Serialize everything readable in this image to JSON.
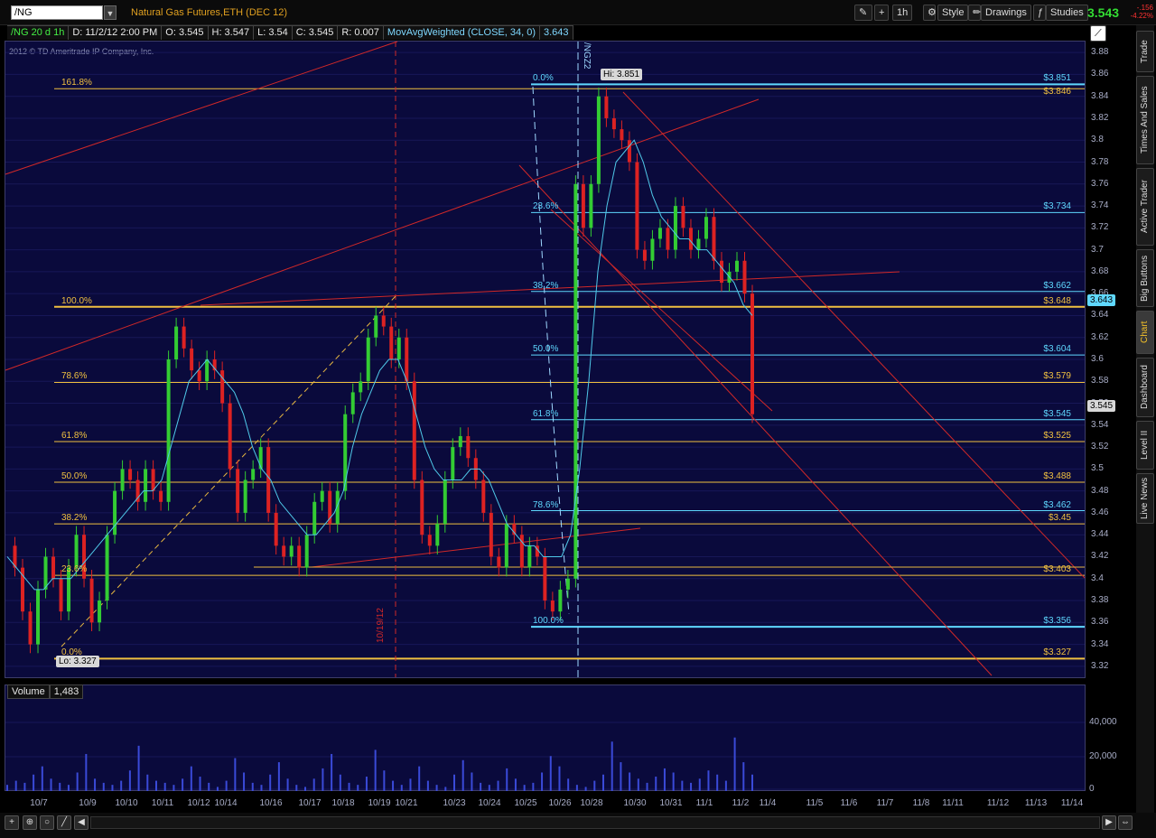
{
  "toolbar": {
    "symbol": "/NG",
    "description": "Natural Gas Futures,ETH (DEC 12)",
    "timeframe": "1h",
    "style_label": "Style",
    "drawings_label": "Drawings",
    "studies_label": "Studies",
    "last_price": "3.543",
    "net_change": "-.156",
    "pct_change": "-4.22%"
  },
  "header": {
    "chart_label": "/NG 20 d 1h",
    "date": "D: 11/2/12 2:00 PM",
    "open": "O: 3.545",
    "high": "H: 3.547",
    "low": "L: 3.54",
    "close": "C: 3.545",
    "range": "R: 0.007",
    "study": "MovAvgWeighted (CLOSE, 34, 0)",
    "study_value": "3.643",
    "copyright": "2012 © TD Ameritrade IP Company, Inc."
  },
  "volume_header": {
    "label": "Volume",
    "value": "1,483"
  },
  "right_tabs": [
    "Trade",
    "Times And Sales",
    "Active Trader",
    "Big Buttons",
    "Chart",
    "Dashboard",
    "Level II",
    "Live News"
  ],
  "active_tab": "Chart",
  "chart_data": {
    "type": "line",
    "title": "",
    "price_axis": {
      "ticks": [
        "3.88",
        "3.86",
        "3.84",
        "3.82",
        "3.8",
        "3.78",
        "3.76",
        "3.74",
        "3.72",
        "3.7",
        "3.68",
        "3.66",
        "3.64",
        "3.62",
        "3.6",
        "3.58",
        "3.56",
        "3.54",
        "3.52",
        "3.5",
        "3.48",
        "3.46",
        "3.44",
        "3.42",
        "3.4",
        "3.38",
        "3.36",
        "3.34",
        "3.32"
      ],
      "ylim": [
        3.31,
        3.89
      ]
    },
    "volume_axis": {
      "ticks": [
        "40,000",
        "20,000",
        "0"
      ]
    },
    "x_ticks": [
      "10/7",
      "10/9",
      "10/10",
      "10/11",
      "10/12",
      "10/14",
      "10/16",
      "10/17",
      "10/18",
      "10/19",
      "10/21",
      "10/23",
      "10/24",
      "10/25",
      "10/26",
      "10/28",
      "10/30",
      "10/31",
      "11/1",
      "11/2",
      "11/4",
      "11/5",
      "11/6",
      "11/7",
      "11/8",
      "11/11",
      "11/12",
      "11/13",
      "11/14"
    ],
    "fib_left": {
      "color": "#f0c040",
      "levels": [
        {
          "label": "161.8%",
          "price": 3.847,
          "value": ""
        },
        {
          "label": "100.0%",
          "price": 3.648,
          "value": "$3.648"
        },
        {
          "label": "78.6%",
          "price": 3.579,
          "value": "$3.579"
        },
        {
          "label": "61.8%",
          "price": 3.525,
          "value": "$3.525"
        },
        {
          "label": "50.0%",
          "price": 3.488,
          "value": "$3.488"
        },
        {
          "label": "38.2%",
          "price": 3.45,
          "value": "$3.45"
        },
        {
          "label": "23.6%",
          "price": 3.403,
          "value": "$3.403"
        },
        {
          "label": "0.0%",
          "price": 3.327,
          "value": "$3.327"
        }
      ]
    },
    "fib_right": {
      "color": "#5fd8ff",
      "levels": [
        {
          "label": "0.0%",
          "price": 3.851,
          "value": "$3.851"
        },
        {
          "label": "23.6%",
          "price": 3.734,
          "value": "$3.734"
        },
        {
          "label": "38.2%",
          "price": 3.662,
          "value": "$3.662"
        },
        {
          "label": "50.0%",
          "price": 3.604,
          "value": "$3.604"
        },
        {
          "label": "61.8%",
          "price": 3.545,
          "value": "$3.545"
        },
        {
          "label": "78.6%",
          "price": 3.462,
          "value": "$3.462"
        },
        {
          "label": "100.0%",
          "price": 3.356,
          "value": "$3.356"
        }
      ]
    },
    "extra_label": "$3.846",
    "annotations": {
      "high": "Hi: 3.851",
      "low": "Lo: 3.327",
      "date_marker": "10/19/12",
      "contract_marker": "/NGZ2",
      "current_price": "3.545",
      "ma_price": "3.643"
    },
    "price_path": [
      3.43,
      3.41,
      3.37,
      3.34,
      3.39,
      3.42,
      3.4,
      3.37,
      3.41,
      3.44,
      3.4,
      3.36,
      3.38,
      3.44,
      3.48,
      3.5,
      3.49,
      3.47,
      3.5,
      3.48,
      3.47,
      3.6,
      3.63,
      3.61,
      3.59,
      3.58,
      3.6,
      3.59,
      3.56,
      3.5,
      3.46,
      3.49,
      3.5,
      3.52,
      3.46,
      3.43,
      3.42,
      3.43,
      3.41,
      3.44,
      3.47,
      3.48,
      3.45,
      3.48,
      3.55,
      3.57,
      3.58,
      3.62,
      3.64,
      3.63,
      3.6,
      3.62,
      3.58,
      3.49,
      3.44,
      3.43,
      3.45,
      3.49,
      3.52,
      3.53,
      3.51,
      3.49,
      3.46,
      3.42,
      3.41,
      3.45,
      3.44,
      3.41,
      3.43,
      3.42,
      3.38,
      3.37,
      3.39,
      3.4,
      3.76,
      3.72,
      3.76,
      3.84,
      3.82,
      3.81,
      3.8,
      3.78,
      3.7,
      3.69,
      3.71,
      3.72,
      3.7,
      3.74,
      3.72,
      3.7,
      3.71,
      3.73,
      3.69,
      3.67,
      3.68,
      3.69,
      3.66,
      3.55
    ],
    "ma_path": [
      3.42,
      3.41,
      3.4,
      3.39,
      3.39,
      3.4,
      3.4,
      3.4,
      3.41,
      3.42,
      3.43,
      3.44,
      3.45,
      3.46,
      3.47,
      3.48,
      3.48,
      3.49,
      3.52,
      3.55,
      3.58,
      3.59,
      3.6,
      3.59,
      3.58,
      3.57,
      3.55,
      3.52,
      3.5,
      3.49,
      3.47,
      3.46,
      3.45,
      3.44,
      3.44,
      3.45,
      3.46,
      3.48,
      3.52,
      3.55,
      3.57,
      3.59,
      3.6,
      3.6,
      3.58,
      3.55,
      3.52,
      3.5,
      3.49,
      3.49,
      3.49,
      3.5,
      3.5,
      3.49,
      3.47,
      3.45,
      3.44,
      3.43,
      3.43,
      3.42,
      3.42,
      3.42,
      3.44,
      3.5,
      3.58,
      3.68,
      3.74,
      3.78,
      3.79,
      3.8,
      3.78,
      3.75,
      3.73,
      3.72,
      3.71,
      3.71,
      3.7,
      3.7,
      3.69,
      3.68,
      3.67,
      3.65,
      3.64
    ],
    "volume_path": [
      3,
      5,
      4,
      8,
      12,
      6,
      4,
      3,
      9,
      18,
      6,
      4,
      3,
      5,
      10,
      22,
      8,
      5,
      4,
      3,
      6,
      12,
      7,
      4,
      2,
      5,
      16,
      9,
      4,
      3,
      8,
      14,
      6,
      3,
      2,
      6,
      11,
      18,
      8,
      4,
      3,
      7,
      20,
      10,
      5,
      3,
      6,
      12,
      5,
      3,
      2,
      8,
      15,
      9,
      4,
      3,
      5,
      11,
      6,
      3,
      4,
      9,
      17,
      12,
      6,
      3,
      2,
      5,
      8,
      24,
      14,
      9,
      6,
      4,
      7,
      11,
      9,
      5,
      4,
      6,
      10,
      8,
      5,
      26,
      14,
      8
    ]
  }
}
